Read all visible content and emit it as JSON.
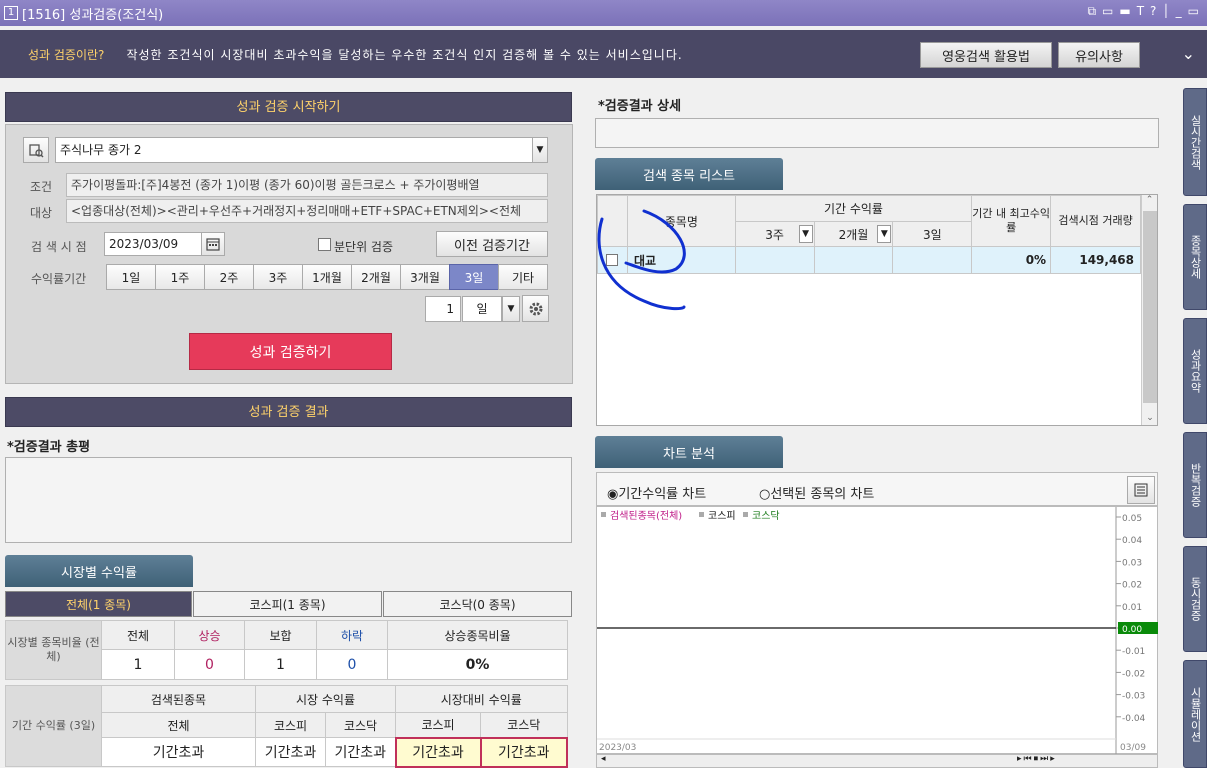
{
  "window": {
    "num": "1",
    "title": "[1516] 성과검증(조건식)",
    "icons": [
      "⧉",
      "▭",
      "▬",
      "T",
      "?",
      "│",
      "_",
      "▭"
    ]
  },
  "banner": {
    "question": "성과 검증이란?",
    "desc": "작성한 조건식이 시장대비 초과수익을 달성하는 우수한 조건식 인지 검증해 볼 수 있는 서비스입니다.",
    "btn1": "영웅검색 활용법",
    "btn2": "유의사항",
    "chev": "⌄"
  },
  "start": {
    "header": "성과 검증 시작하기",
    "condition_name": "주식나무 종가 2",
    "label_cond": "조건",
    "cond_text": "주가이평돌파:[주]4봉전 (종가 1)이평 (종가 60)이평 골든크로스 + 주가이평배열",
    "label_target": "대상",
    "target_text": "<업종대상(전체)><관리+우선주+거래정지+정리매매+ETF+SPAC+ETN제외><전체",
    "label_date": "검 색 시 점",
    "date": "2023/03/09",
    "checkbox_label": "분단위 검증",
    "prev_btn": "이전 검증기간",
    "label_period": "수익률기간",
    "periods": [
      "1일",
      "1주",
      "2주",
      "3주",
      "1개월",
      "2개월",
      "3개월",
      "3일",
      "기타"
    ],
    "active_period": "3일",
    "num_value": "1",
    "unit_value": "일",
    "run_btn": "성과 검증하기"
  },
  "result": {
    "header": "성과 검증 결과",
    "summary_label": "*검증결과 총평"
  },
  "market": {
    "tab_header": "시장별 수익률",
    "tabs": [
      "전체(1 종목)",
      "코스피(1 종목)",
      "코스닥(0 종목)"
    ],
    "ratio": {
      "row_label": "시장별 종목비율 (전체)",
      "headers": [
        "전체",
        "상승",
        "보합",
        "하락",
        "상승종목비율"
      ],
      "values": [
        "1",
        "0",
        "1",
        "0",
        "0%"
      ]
    },
    "period": {
      "row_label": "기간 수익률 (3일)",
      "h1": [
        "검색된종목",
        "시장 수익률",
        "시장대비 수익률"
      ],
      "h2": [
        "전체",
        "코스피",
        "코스닥",
        "코스피",
        "코스닥"
      ],
      "values": [
        "기간초과",
        "기간초과",
        "기간초과",
        "기간초과",
        "기간초과"
      ]
    }
  },
  "detail": {
    "label": "*검증결과 상세"
  },
  "list": {
    "tab": "검색 종목 리스트",
    "col_name": "종목명",
    "col_period": "기간 수익률",
    "sub": [
      "3주",
      "2개월",
      "3일"
    ],
    "col_max": "기간 내 최고수익률",
    "col_vol": "검색시점 거래량",
    "rows": [
      {
        "name": "대교",
        "max": "0%",
        "vol": "149,468"
      }
    ]
  },
  "chart": {
    "tab": "차트 분석",
    "radio1": "기간수익률 차트",
    "radio2": "선택된 종목의 차트",
    "legend": [
      {
        "label": "검색된종목(전체)",
        "color": "#c0208a"
      },
      {
        "label": "코스피",
        "color": "#111111"
      },
      {
        "label": "코스닥",
        "color": "#1a7a1a"
      }
    ],
    "x_start": "2023/03",
    "x_end": "03/09"
  },
  "chart_data": {
    "type": "line",
    "x": [
      "2023/03",
      "03/09"
    ],
    "series": [],
    "ylim": [
      -0.05,
      0.05
    ],
    "yticks": [
      "0.05",
      "0.04",
      "0.03",
      "0.02",
      "0.01",
      "0.00",
      "-0.01",
      "-0.02",
      "-0.03",
      "-0.04"
    ],
    "current": "0.00"
  },
  "sidebar": [
    "실시간검색",
    "종목상세",
    "성과요약",
    "반복검증",
    "동시검증",
    "시뮬레이션"
  ]
}
